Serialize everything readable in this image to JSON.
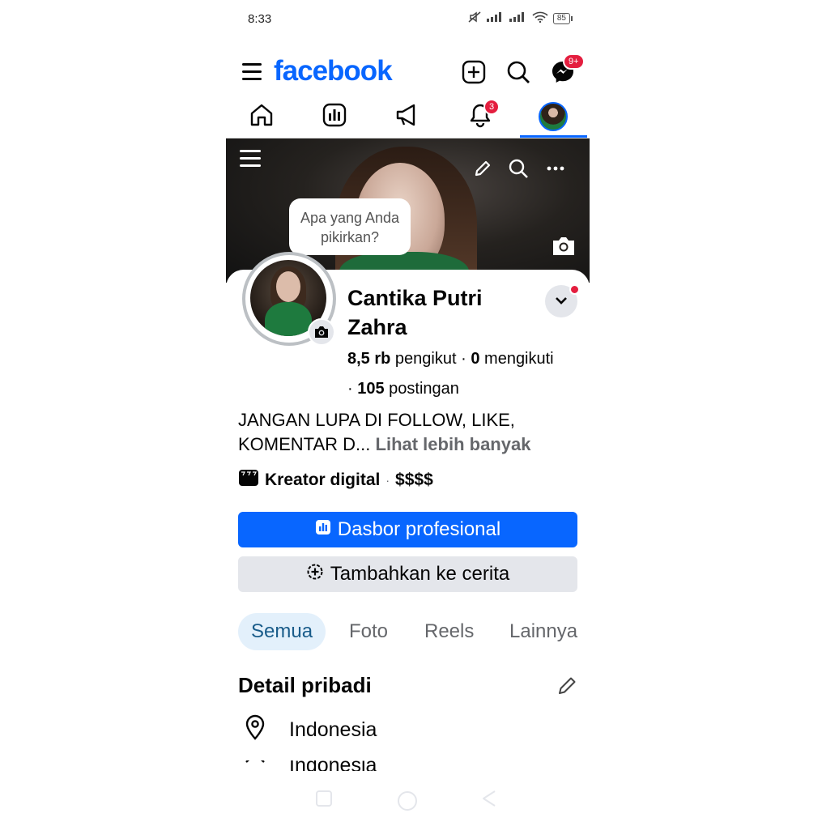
{
  "status": {
    "time": "8:33",
    "battery": "85"
  },
  "header": {
    "logo": "facebook",
    "messenger_badge": "9+"
  },
  "tabs": {
    "notifications_badge": "3"
  },
  "cover": {
    "prompt": "Apa yang Anda pikirkan?"
  },
  "profile": {
    "name": "Cantika Putri Zahra",
    "followers": "8,5 rb",
    "followers_label": "pengikut",
    "separator": "·",
    "following": "0",
    "following_label": "mengikuti",
    "posts": "105",
    "posts_label": "postingan",
    "bio": "JANGAN LUPA DI FOLLOW, LIKE, KOMENTAR D...",
    "see_more": "Lihat lebih banyak",
    "category": "Kreator digital",
    "price": "$$$$"
  },
  "buttons": {
    "dashboard": "Dasbor profesional",
    "add_story": "Tambahkan ke cerita"
  },
  "filter_tabs": [
    "Semua",
    "Foto",
    "Reels",
    "Lainnya"
  ],
  "details": {
    "title": "Detail pribadi",
    "items": [
      "Indonesia",
      "Indonesia"
    ]
  },
  "colors": {
    "brand": "#0866ff",
    "badge": "#e41e3f",
    "chip_active_bg": "#e3f0fb"
  }
}
